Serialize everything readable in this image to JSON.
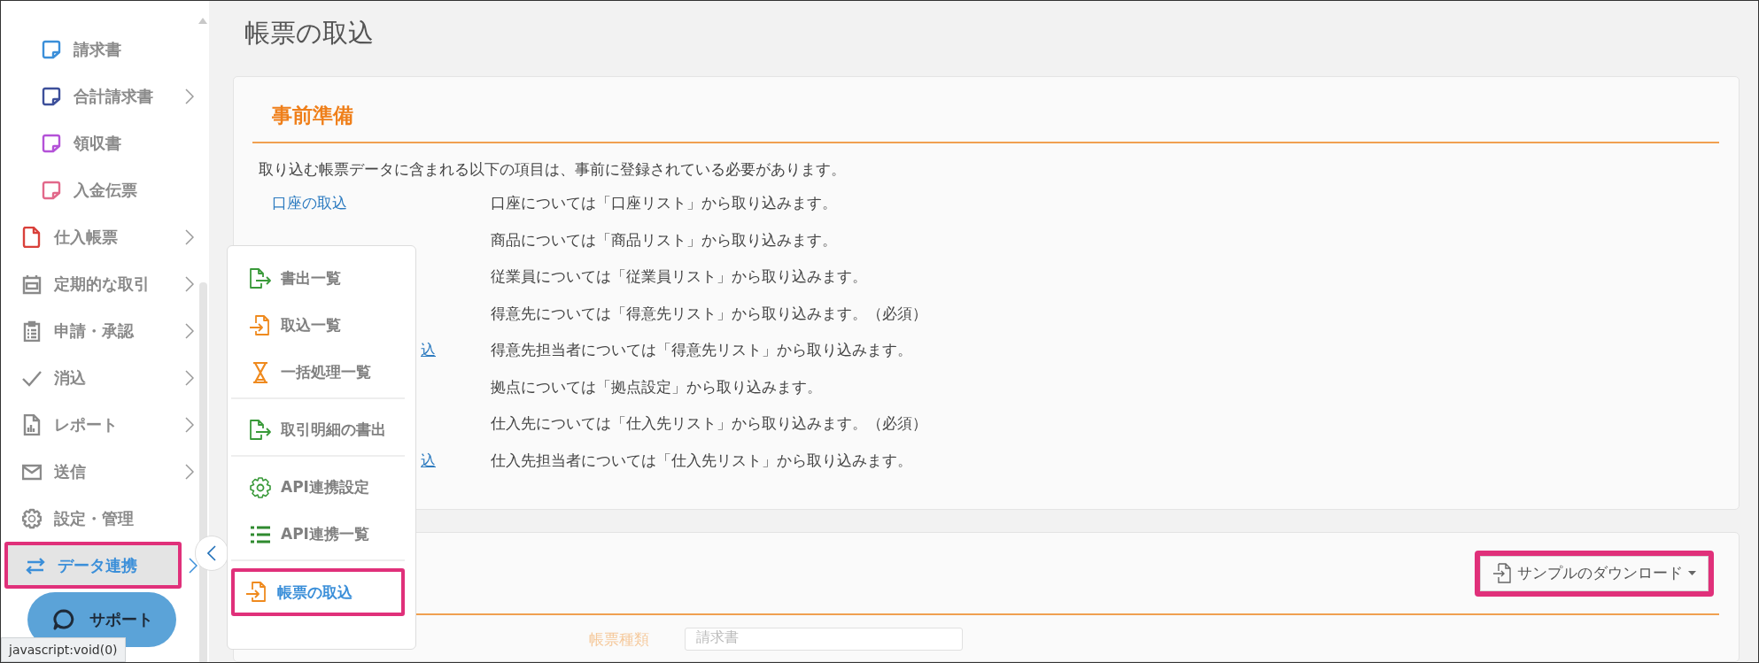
{
  "sidebar": {
    "items": [
      {
        "label": "請求書",
        "kind": "sub",
        "color": "#3b8fd9",
        "expandable": false,
        "selected": false,
        "highlighted": false
      },
      {
        "label": "合計請求書",
        "kind": "sub",
        "color": "#3d4f9a",
        "expandable": true,
        "selected": false,
        "highlighted": false
      },
      {
        "label": "領収書",
        "kind": "sub",
        "color": "#b452d8",
        "expandable": false,
        "selected": false,
        "highlighted": false
      },
      {
        "label": "入金伝票",
        "kind": "sub",
        "color": "#e2688a",
        "expandable": false,
        "selected": false,
        "highlighted": false
      },
      {
        "label": "仕入帳票",
        "kind": "main",
        "color": "#d9403a",
        "expandable": true,
        "selected": false,
        "highlighted": false
      },
      {
        "label": "定期的な取引",
        "kind": "main",
        "color": "#8a8a8a",
        "expandable": true,
        "selected": false,
        "highlighted": false
      },
      {
        "label": "申請・承認",
        "kind": "main",
        "color": "#8a8a8a",
        "expandable": true,
        "selected": false,
        "highlighted": false
      },
      {
        "label": "消込",
        "kind": "main",
        "color": "#8a8a8a",
        "expandable": true,
        "selected": false,
        "highlighted": false
      },
      {
        "label": "レポート",
        "kind": "main",
        "color": "#8a8a8a",
        "expandable": true,
        "selected": false,
        "highlighted": false
      },
      {
        "label": "送信",
        "kind": "main",
        "color": "#8a8a8a",
        "expandable": true,
        "selected": false,
        "highlighted": false
      },
      {
        "label": "設定・管理",
        "kind": "main",
        "color": "#8a8a8a",
        "expandable": false,
        "selected": false,
        "highlighted": false
      },
      {
        "label": "データ連携",
        "kind": "main",
        "color": "#3b8fd9",
        "expandable": true,
        "selected": true,
        "highlighted": true
      }
    ],
    "support_button": "サポート"
  },
  "page_title": "帳票の取込",
  "preparation": {
    "heading": "事前準備",
    "intro": "取り込む帳票データに含まれる以下の項目は、事前に登録されている必要があります。",
    "rows": [
      {
        "link": "口座の取込",
        "covered": false,
        "description": "口座については「口座リスト」から取り込みます。"
      },
      {
        "description": "商品については「商品リスト」から取り込みます。"
      },
      {
        "description": "従業員については「従業員リスト」から取り込みます。"
      },
      {
        "description": "得意先については「得意先リスト」から取り込みます。（必須）"
      },
      {
        "link": "込",
        "covered": true,
        "description": "得意先担当者については「得意先リスト」から取り込みます。"
      },
      {
        "description": "拠点については「拠点設定」から取り込みます。"
      },
      {
        "description": "仕入先については「仕入先リスト」から取り込みます。（必須）"
      },
      {
        "link": "込",
        "covered": true,
        "description": "仕入先担当者については「仕入先リスト」から取り込みます。"
      }
    ]
  },
  "import_section": {
    "download_button": {
      "label": "サンプルのダウンロード",
      "highlighted": true
    },
    "form_label": "帳票種類",
    "form_select": "請求書"
  },
  "popup_menu": {
    "groups": [
      [
        {
          "label": "書出一覧",
          "selected": false,
          "highlighted": false
        },
        {
          "label": "取込一覧",
          "selected": false,
          "highlighted": false
        },
        {
          "label": "一括処理一覧",
          "selected": false,
          "highlighted": false
        }
      ],
      [
        {
          "label": "取引明細の書出",
          "selected": false,
          "highlighted": false
        }
      ],
      [
        {
          "label": "API連携設定",
          "selected": false,
          "highlighted": false
        },
        {
          "label": "API連携一覧",
          "selected": false,
          "highlighted": false
        }
      ],
      [
        {
          "label": "帳票の取込",
          "selected": true,
          "highlighted": true
        }
      ]
    ]
  },
  "status_tooltip": "javascript:void(0)"
}
